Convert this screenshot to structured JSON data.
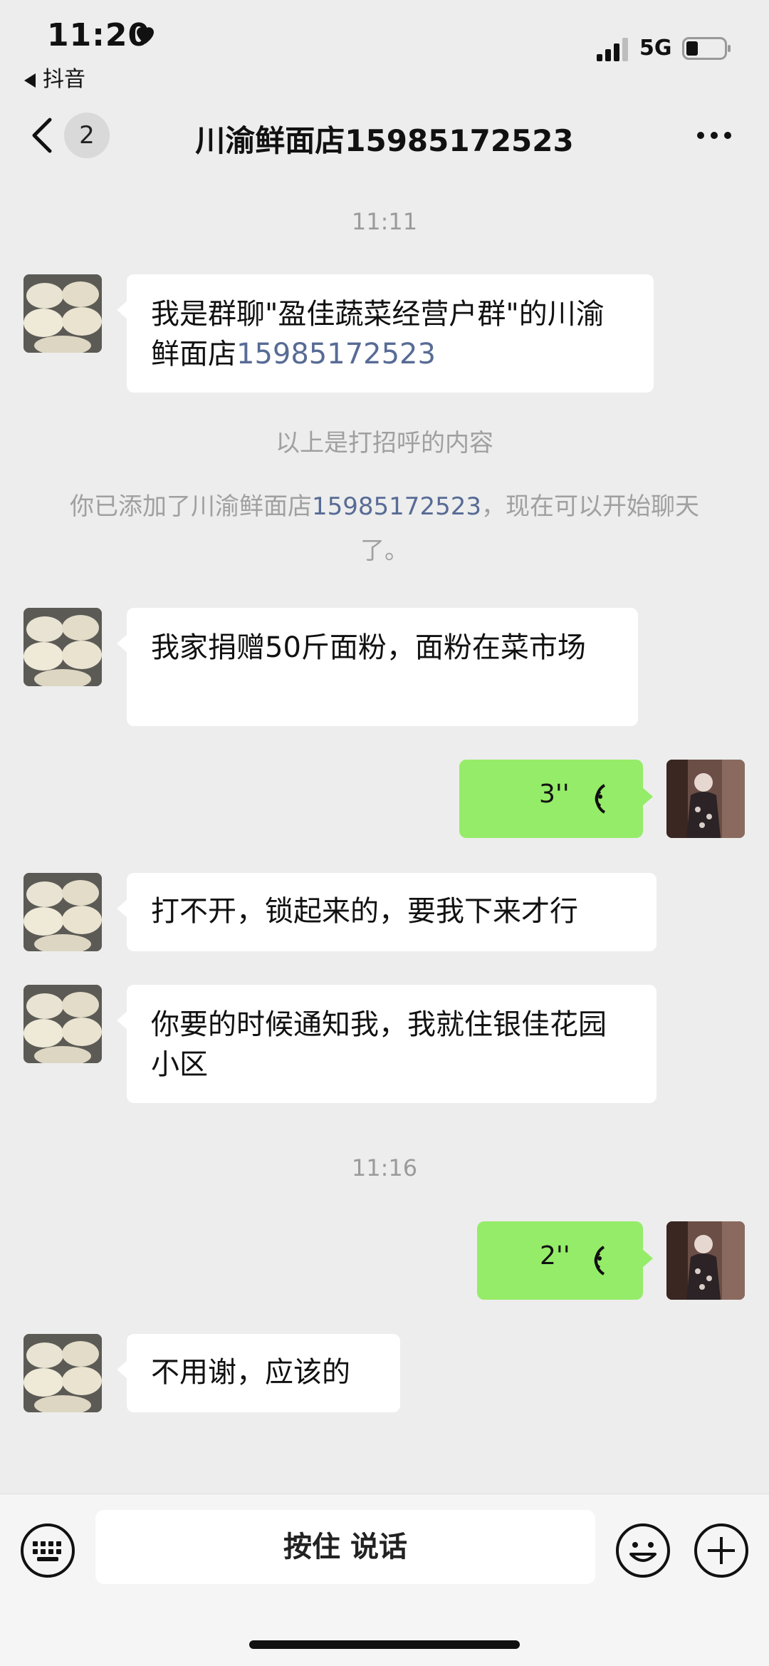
{
  "status_bar": {
    "time": "11:20",
    "back_app": "抖音",
    "network": "5G",
    "icons": [
      "heart-icon",
      "signal-icon",
      "battery-icon"
    ]
  },
  "nav": {
    "unread_count": "2",
    "title": "川渝鲜面店15985172523",
    "icons": [
      "back-chevron-icon",
      "more-icon"
    ]
  },
  "messages": {
    "ts1": "11:11",
    "m1_a": "我是群聊\"盈佳蔬菜经营户群\"的川渝鲜面店",
    "m1_b": "15985172523",
    "greeting_note": "以上是打招呼的内容",
    "added_a": "你已添加了川渝鲜面店",
    "added_b": "15985172523",
    "added_c": "，现在可以开始聊天了。",
    "m2": "我家捐赠50斤面粉，面粉在菜市场",
    "v1": "3''",
    "m3": "打不开，锁起来的，要我下来才行",
    "m4": "你要的时候通知我，我就住银佳花园小区",
    "ts2": "11:16",
    "v2": "2''",
    "m5": "不用谢，应该的"
  },
  "input_bar": {
    "hold_to_talk": "按住 说话",
    "icons": [
      "keyboard-icon",
      "emoji-icon",
      "plus-icon"
    ]
  },
  "colors": {
    "background": "#ededed",
    "outgoing_bubble": "#95ec69",
    "incoming_bubble": "#ffffff",
    "link": "#576b95"
  }
}
